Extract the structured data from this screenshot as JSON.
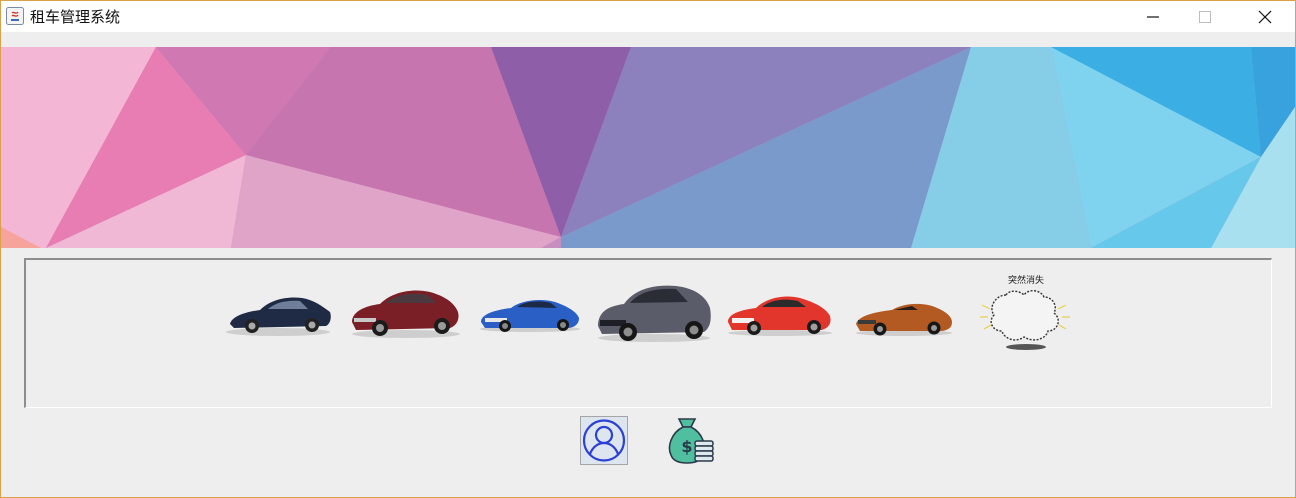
{
  "window": {
    "title": "租车管理系统",
    "controls": {
      "minimize": "minimize-icon",
      "maximize": "maximize-icon",
      "close": "close-icon"
    }
  },
  "banner": {
    "image": "low-poly-gradient-banner",
    "colors": [
      "#f3b4d3",
      "#e57db2",
      "#8e5ca6",
      "#7c95cc",
      "#86d2e8",
      "#3ba7e0"
    ]
  },
  "gallery": {
    "cars": [
      {
        "name": "dark-blue-sedan",
        "color": "#1f2b45"
      },
      {
        "name": "dark-red-sedan",
        "color": "#7a1f25"
      },
      {
        "name": "blue-sports-car",
        "color": "#2a5fc6"
      },
      {
        "name": "grey-suv",
        "color": "#5a5d69"
      },
      {
        "name": "red-coupe",
        "color": "#e2362c"
      },
      {
        "name": "orange-roadster",
        "color": "#b35a22"
      },
      {
        "name": "vanished-placeholder",
        "caption": "突然消失"
      }
    ]
  },
  "actions": [
    {
      "name": "user-button",
      "icon": "user-icon"
    },
    {
      "name": "money-button",
      "icon": "money-bag-icon"
    }
  ]
}
